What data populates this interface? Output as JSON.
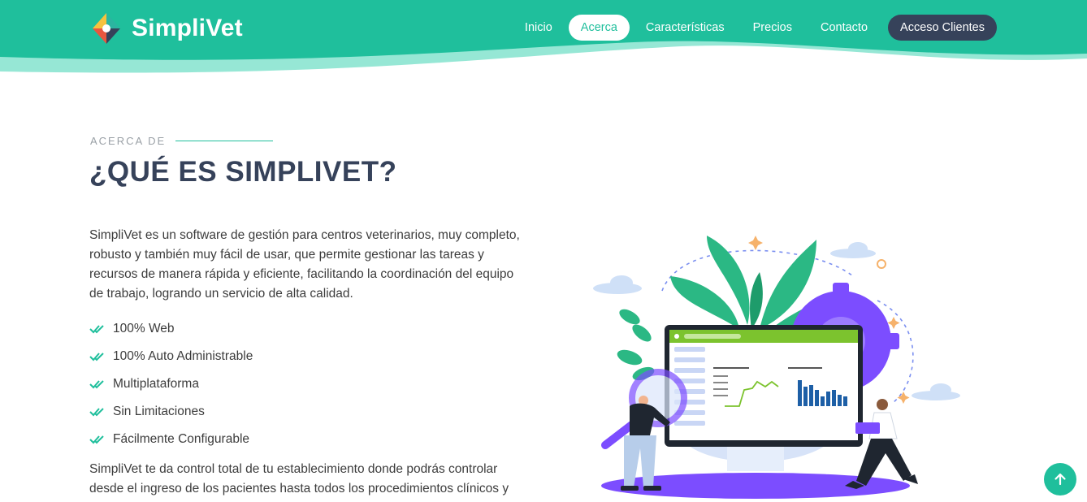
{
  "brand": {
    "name": "SimpliVet"
  },
  "nav": {
    "items": [
      {
        "label": "Inicio"
      },
      {
        "label": "Acerca"
      },
      {
        "label": "Características"
      },
      {
        "label": "Precios"
      },
      {
        "label": "Contacto"
      }
    ],
    "cta_label": "Acceso Clientes"
  },
  "about": {
    "eyebrow": "ACERCA DE",
    "title": "¿QUÉ ES SIMPLIVET?",
    "intro": "SimpliVet es un software de gestión para centros veterinarios, muy completo, robusto y también muy fácil de usar, que permite gestionar las tareas y recursos de manera rápida y eficiente, facilitando la coordinación del equipo de trabajo, logrando un servicio de alta calidad.",
    "features": [
      "100% Web",
      "100% Auto Administrable",
      "Multiplataforma",
      "Sin Limitaciones",
      "Fácilmente Configurable"
    ],
    "outro": "SimpliVet te da control total de tu establecimiento donde podrás controlar desde el ingreso de los pacientes hasta todos los procedimientos clínicos y"
  },
  "colors": {
    "brand": "#1fbf9c",
    "dark": "#36425a",
    "accent": "#7c4dff"
  },
  "icons": {
    "check": "double-check-icon",
    "back_to_top": "arrow-up-icon"
  }
}
